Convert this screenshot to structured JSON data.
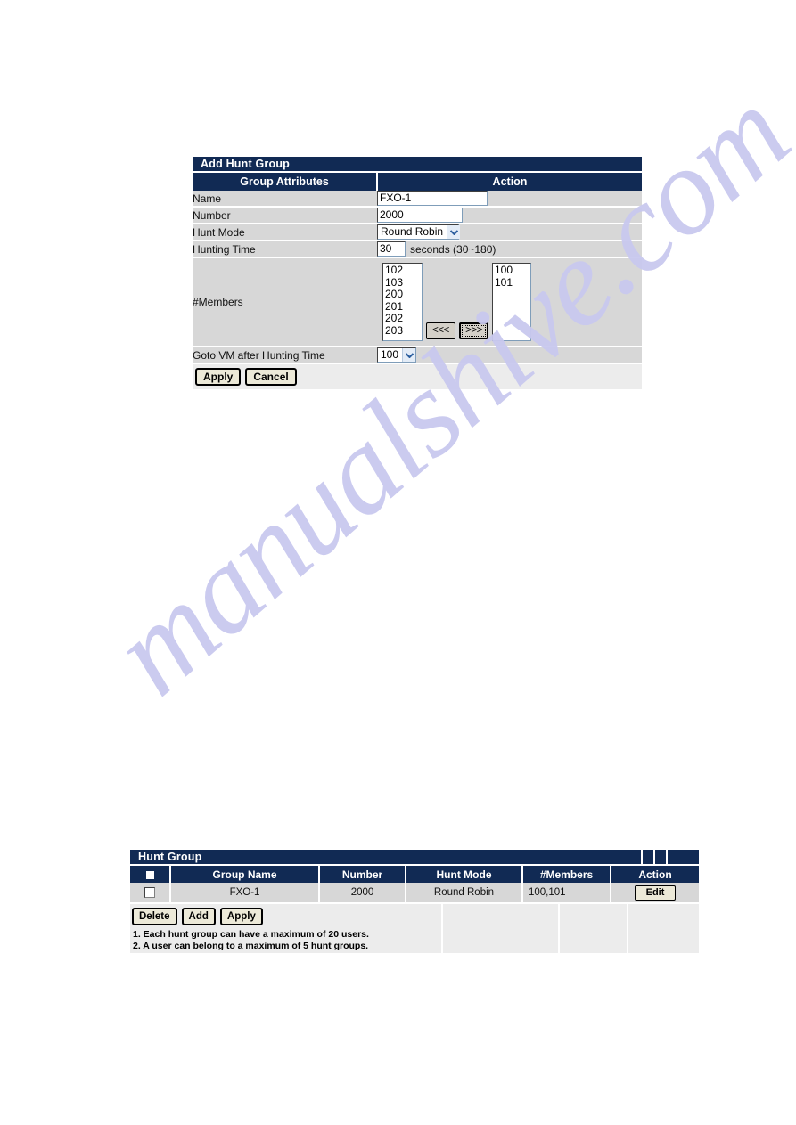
{
  "watermark": {
    "text": "manualshive.com"
  },
  "add_panel": {
    "title": "Add Hunt Group",
    "columns": {
      "attributes": "Group Attributes",
      "action": "Action"
    },
    "rows": {
      "name": {
        "label": "Name",
        "value": "FXO-1"
      },
      "number": {
        "label": "Number",
        "value": "2000"
      },
      "hunt_mode": {
        "label": "Hunt Mode",
        "value": "Round Robin"
      },
      "hunting_time": {
        "label": "Hunting Time",
        "value": "30",
        "unit": "seconds (30~180)"
      },
      "members": {
        "label": "#Members"
      },
      "goto_vm": {
        "label": "Goto VM after Hunting Time",
        "value": "100"
      }
    },
    "members": {
      "available": [
        "102",
        "103",
        "200",
        "201",
        "202",
        "203"
      ],
      "selected": [
        "100",
        "101"
      ],
      "move_left_label": "<<<",
      "move_right_label": ">>>"
    },
    "buttons": {
      "apply": "Apply",
      "cancel": "Cancel"
    }
  },
  "list_panel": {
    "title": "Hunt Group",
    "headers": [
      "",
      "Group Name",
      "Number",
      "Hunt Mode",
      "#Members",
      "Action"
    ],
    "rows": [
      {
        "group_name": "FXO-1",
        "number": "2000",
        "hunt_mode": "Round Robin",
        "members": "100,101",
        "action_label": "Edit"
      }
    ],
    "buttons": {
      "delete": "Delete",
      "add": "Add",
      "apply": "Apply"
    },
    "notes": [
      "1. Each hunt group can have a maximum of 20 users.",
      "2. A user can belong to a maximum of 5 hunt groups."
    ]
  },
  "colors": {
    "header_navy": "#112a54",
    "row_gray": "#d7d7d7",
    "footer_gray": "#ececec",
    "watermark": "#c9c9ef"
  }
}
